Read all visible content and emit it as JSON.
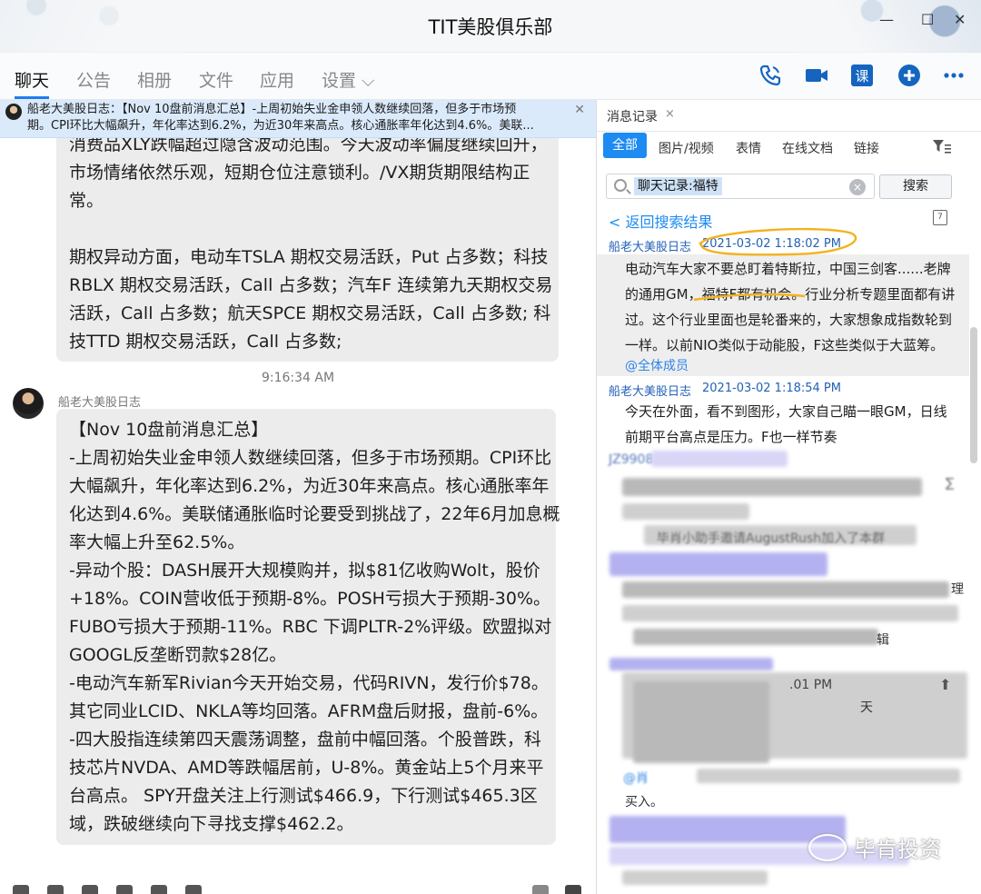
{
  "window": {
    "title": "TIT美股俱乐部",
    "controls": [
      "—",
      "☐",
      "✕"
    ]
  },
  "nav": {
    "tabs": [
      "聊天",
      "公告",
      "相册",
      "文件",
      "应用",
      "设置 ⌵"
    ],
    "icons": [
      "phone-icon",
      "video-call-icon",
      "lesson-icon",
      "add-icon",
      "more-icon"
    ],
    "lesson_label": "课"
  },
  "notice": {
    "line1": "船老大美股日志：【Nov 10盘前消息汇总】-上周初始失业金申领人数继续回落，但多于市场预",
    "line2": "期。CPI环比大幅飙升，年化率达到6.2%，为近30年来高点。核心通胀率年化达到4.6%。美联..."
  },
  "chat": {
    "message1": {
      "lines": [
        "消费品XLY跌幅超过隐含波动范围。今天波动率偏度继续回升，",
        "市场情绪依然乐观，短期仓位注意锁利。/VX期货期限结构正",
        "常。",
        "",
        "期权异动方面，电动车TSLA 期权交易活跃，Put 占多数；科技",
        "RBLX 期权交易活跃，Call 占多数；汽车F 连续第九天期权交易",
        "活跃，Call 占多数；航天SPCE 期权交易活跃，Call 占多数; 科",
        "技TTD 期权交易活跃，Call 占多数;"
      ]
    },
    "timestamp": "9:16:34 AM",
    "sender": "船老大美股日志",
    "message2": {
      "lines": [
        "【Nov 10盘前消息汇总】",
        "-上周初始失业金申领人数继续回落，但多于市场预期。CPI环比",
        "大幅飙升，年化率达到6.2%，为近30年来高点。核心通胀率年",
        "化达到4.6%。美联储通胀临时论要受到挑战了，22年6月加息概",
        "率大幅上升至62.5%。",
        "-异动个股：DASH展开大规模购并，拟$81亿收购Wolt，股价",
        "+18%。COIN营收低于预期-8%。POSH亏损大于预期-30%。",
        "FUBO亏损大于预期-11%。RBC 下调PLTR-2%评级。欧盟拟对",
        "GOOGL反垄断罚款$28亿。",
        "-电动汽车新军Rivian今天开始交易，代码RIVN，发行价$78。",
        "其它同业LCID、NKLA等均回落。AFRM盘后财报，盘前-6%。",
        "-四大股指连续第四天震荡调整，盘前中幅回落。个股普跌，科",
        "技芯片NVDA、AMD等跌幅居前，U-8%。黄金站上5个月来平",
        "台高点。 SPY开盘关注上行测试$466.9，下行测试$465.3区",
        "域，跌破继续向下寻找支撑$462.2。"
      ]
    }
  },
  "panel": {
    "tab_label": "消息记录",
    "tab_close": "×",
    "filters": [
      "全部",
      "图片/视频",
      "表情",
      "在线文档",
      "链接"
    ],
    "search": {
      "value": "聊天记录:福特",
      "clear": "×",
      "button": "搜索"
    },
    "back_link": "< 返回搜索结果",
    "calendar_label": "7",
    "results": [
      {
        "sender": "船老大美股日志",
        "time": "2021-03-02 1:18:02 PM",
        "lines": [
          "电动汽车大家不要总盯着特斯拉，中国三剑客......老牌",
          "的通用GM，福特F都有机会。行业分析专题里面都有讲",
          "过。这个行业里面也是轮番来的，大家想象成指数轮到",
          "一样。以前NIO类似于动能股，F这些类似于大蓝筹。"
        ],
        "mention": "@全体成员"
      },
      {
        "sender": "船老大美股日志",
        "time": "2021-03-02 1:18:54 PM",
        "lines": [
          "今天在外面，看不到图形，大家自己瞄一眼GM，日线",
          "前期平台高点是压力。F也一样节奏"
        ]
      }
    ],
    "partial_texts": {
      "p1": "JZ9908 2021-03-02 1:1...",
      "p2": "毕肖小助手邀请AugustRush加入了本群",
      "p3": "辑",
      "p4": ".01 PM",
      "p5": "天",
      "p6": "理",
      "p7": "@肖",
      "p8": "买入。",
      "p9": "∑"
    }
  },
  "watermark": {
    "text": "毕肯投资"
  }
}
